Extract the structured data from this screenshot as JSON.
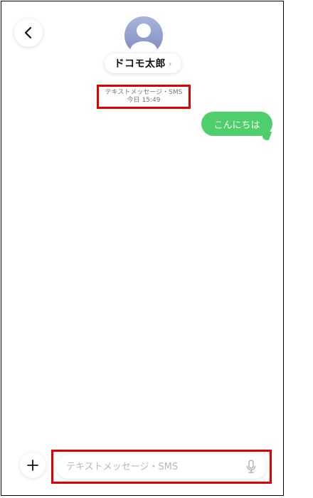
{
  "header": {
    "back_icon": "chevron-left-icon",
    "avatar_icon": "person-avatar-icon",
    "contact_name": "ドコモ太郎",
    "contact_chevron": "›"
  },
  "conversation": {
    "meta_title": "テキストメッセージ・SMS",
    "meta_time": "今日 15:49",
    "messages": [
      {
        "direction": "outgoing",
        "text": "こんにちは",
        "color": "#4ecf6b"
      }
    ]
  },
  "composer": {
    "add_icon": "plus-icon",
    "placeholder": "テキストメッセージ・SMS",
    "mic_icon": "microphone-icon"
  },
  "highlight_color": "#e00000"
}
